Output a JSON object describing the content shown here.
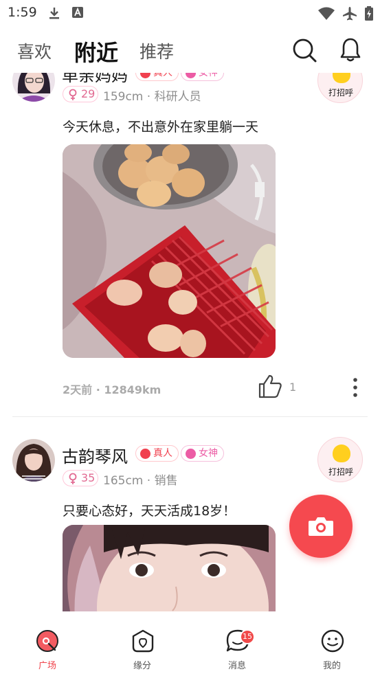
{
  "status_bar": {
    "time": "1:59",
    "left_icons": [
      "download-icon",
      "text-a-icon"
    ],
    "right_icons": [
      "wifi-icon",
      "airplane-icon",
      "battery-icon"
    ]
  },
  "header": {
    "tabs": [
      {
        "label": "喜欢",
        "active": false
      },
      {
        "label": "附近",
        "active": true
      },
      {
        "label": "推荐",
        "active": false
      }
    ],
    "icons": [
      "search-icon",
      "bell-icon"
    ]
  },
  "posts": [
    {
      "name": "单亲妈妈",
      "badges": [
        "真人",
        "女神"
      ],
      "age": "29",
      "meta": "159cm · 科研人员",
      "greet_label": "打招呼",
      "text": "今天休息，不出意外在家里躺一天",
      "photo_subject": "eggs-in-basket-photo",
      "time_distance": "2天前 · 12849km",
      "likes": "1"
    },
    {
      "name": "古韵琴风",
      "badges": [
        "真人",
        "女神"
      ],
      "age": "35",
      "meta": "165cm · 销售",
      "greet_label": "打招呼",
      "text": "只要心态好，天天活成18岁！",
      "photo_subject": "selfie-photo"
    }
  ],
  "camera_button_icon": "camera-icon",
  "bottom_nav": {
    "items": [
      {
        "label": "广场",
        "icon": "plaza-icon",
        "active": true
      },
      {
        "label": "缘分",
        "icon": "fate-icon",
        "active": false
      },
      {
        "label": "消息",
        "icon": "message-icon",
        "active": false
      },
      {
        "label": "我的",
        "icon": "profile-icon",
        "active": false
      }
    ],
    "message_badge": "15"
  },
  "colors": {
    "accent": "#f5494f",
    "badge_real": "#f0404e",
    "badge_goddess": "#ec5ca5",
    "greet_bg": "#fdeff1"
  }
}
